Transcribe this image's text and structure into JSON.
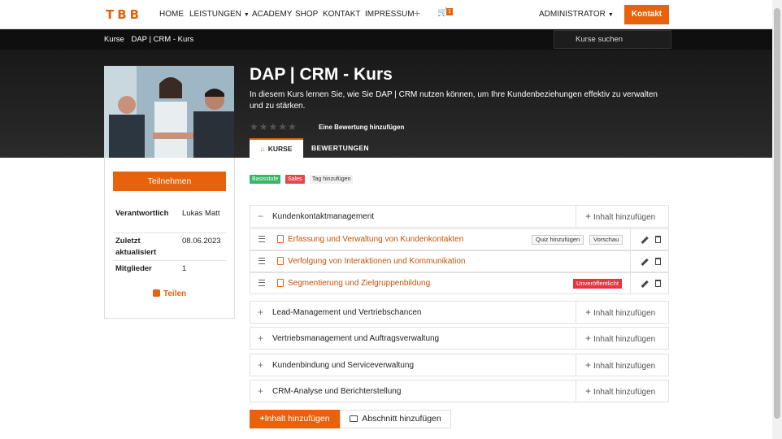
{
  "nav": {
    "logo": "TBB",
    "items": [
      "HOME",
      "LEISTUNGEN",
      "ACADEMY",
      "SHOP",
      "KONTAKT",
      "IMPRESSUM"
    ],
    "cart_count": "1",
    "user": "ADMINISTRATOR",
    "cta": "Kontakt"
  },
  "breadcrumb": {
    "root": "Kurse",
    "current": "DAP | CRM - Kurs"
  },
  "search": {
    "placeholder": "Kurse suchen"
  },
  "course": {
    "title": "DAP | CRM - Kurs",
    "description": "In diesem Kurs lernen Sie, wie Sie DAP | CRM nutzen können, um Ihre Kundenbeziehungen effektiv zu verwalten und zu stärken.",
    "rating_link": "Eine Bewertung hinzufügen",
    "rating": 0,
    "tabs": {
      "courses": "KURSE",
      "reviews": "BEWERTUNGEN"
    }
  },
  "sidebar": {
    "join": "Teilnehmen",
    "rows": [
      {
        "label": "Verantwortlich",
        "value": "Lukas Matt"
      },
      {
        "label": "Zuletzt aktualisiert",
        "value": "08.06.2023"
      },
      {
        "label": "Mitglieder",
        "value": "1"
      }
    ],
    "share": "Teilen"
  },
  "tags": [
    {
      "label": "Basisstufe",
      "color": "#35b765"
    },
    {
      "label": "Sales",
      "color": "#e8474f"
    },
    {
      "label": "Tag hinzufügen",
      "color": "#f0f0f0"
    }
  ],
  "content": {
    "add_label": "Inhalt hinzufügen",
    "sections": [
      {
        "title": "Kundenkontaktmanagement",
        "expanded": true
      },
      {
        "title": "Lead-Management und Vertriebschancen",
        "expanded": false
      },
      {
        "title": "Vertriebsmanagement und Auftragsverwaltung",
        "expanded": false
      },
      {
        "title": "Kundenbindung und Serviceverwaltung",
        "expanded": false
      },
      {
        "title": "CRM-Analyse und Berichterstellung",
        "expanded": false
      }
    ],
    "lessons": [
      {
        "title": "Erfassung und Verwaltung von Kundenkontakten",
        "quiz": "Quiz hinzufügen",
        "preview": "Vorschau"
      },
      {
        "title": "Verfolgung von Interaktionen und Kommunikation"
      },
      {
        "title": "Segmentierung und Zielgruppenbildung",
        "status": "Unveröffentlicht"
      }
    ],
    "bottom_add": "Inhalt hinzufügen",
    "bottom_section": "Abschnitt hinzufügen"
  },
  "colors": {
    "accent": "#e8620c",
    "dark": "#1a1a1a"
  }
}
